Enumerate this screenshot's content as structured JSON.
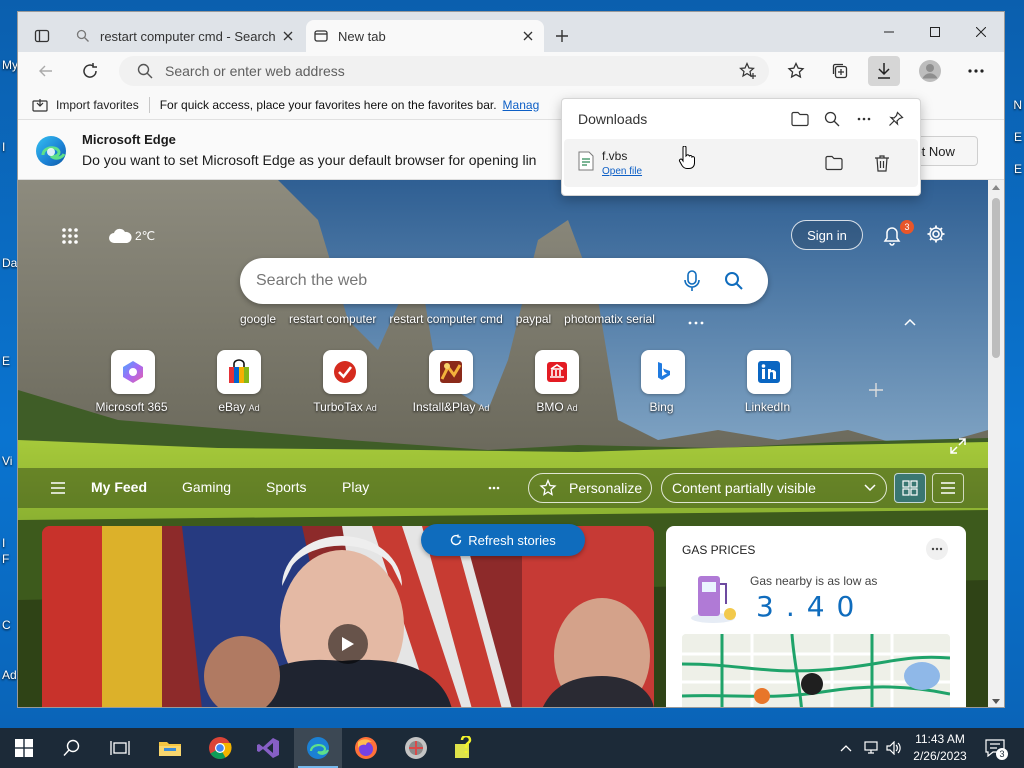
{
  "desktop": {
    "left_labels": [
      "My",
      "I",
      "Da",
      "E",
      "Vi",
      "I",
      "F",
      "C",
      "Ad"
    ],
    "right_labels": [
      "N",
      "E",
      "E"
    ]
  },
  "browser": {
    "tabs": [
      {
        "label": "restart computer cmd - Search",
        "icon": "search-icon"
      },
      {
        "label": "New tab",
        "icon": "newtab-icon"
      }
    ],
    "address": {
      "placeholder": "Search or enter web address"
    },
    "favorites_bar": {
      "import_label": "Import favorites",
      "message": "For quick access, place your favorites here on the favorites bar.",
      "manage_link": "Manag"
    },
    "infobar": {
      "title": "Microsoft Edge",
      "text": "Do you want to set Microsoft Edge as your default browser for opening lin",
      "not_now": "Not Now"
    },
    "downloads": {
      "title": "Downloads",
      "file_name": "f.vbs",
      "open_label": "Open file"
    }
  },
  "newtab": {
    "weather": "2℃",
    "sign_in": "Sign in",
    "notifications_count": "3",
    "search_placeholder": "Search the web",
    "quick_searches": [
      "google",
      "restart computer",
      "restart computer cmd",
      "paypal",
      "photomatix serial"
    ],
    "tiles": [
      {
        "label": "Microsoft 365",
        "ad": ""
      },
      {
        "label": "eBay",
        "ad": "Ad"
      },
      {
        "label": "TurboTax",
        "ad": "Ad"
      },
      {
        "label": "Install&Play",
        "ad": "Ad"
      },
      {
        "label": "BMO",
        "ad": "Ad"
      },
      {
        "label": "Bing",
        "ad": ""
      },
      {
        "label": "LinkedIn",
        "ad": ""
      }
    ],
    "feed_tabs": [
      "My Feed",
      "Gaming",
      "Sports",
      "Play"
    ],
    "personalize": "Personalize",
    "content_visibility": "Content partially visible",
    "refresh": "Refresh stories",
    "gas": {
      "title": "GAS PRICES",
      "subtitle": "Gas nearby is as low as",
      "price": "3.40"
    }
  },
  "taskbar": {
    "time": "11:43 AM",
    "date": "2/26/2023",
    "notification_count": "3"
  },
  "colors": {
    "accent": "#0f6cbd",
    "taskbar": "#1c2a38"
  }
}
